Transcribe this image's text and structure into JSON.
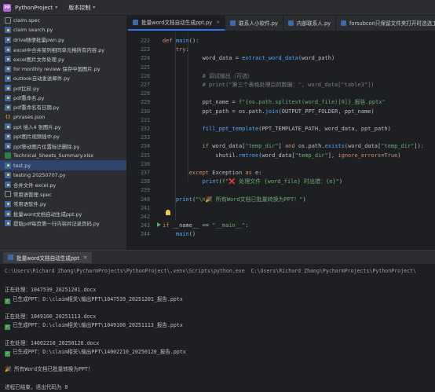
{
  "titlebar": {
    "app_logo": "PP",
    "project_name": "PythonProject",
    "vcs_label": "版本控制"
  },
  "project_tree": {
    "items": [
      {
        "label": "claim.spec",
        "type": "spec"
      },
      {
        "label": "claim search.py",
        "type": "py"
      },
      {
        "label": "drive随便批量pwn.py",
        "type": "py"
      },
      {
        "label": "excel中合并某列相同单元格所有内容.py",
        "type": "py"
      },
      {
        "label": "excel图片文件处理.py",
        "type": "py"
      },
      {
        "label": "for monthly review 保存中国图片.py",
        "type": "py"
      },
      {
        "label": "outlook自动发送邮件.py",
        "type": "py"
      },
      {
        "label": "pdf比较.py",
        "type": "py"
      },
      {
        "label": "pdf重命名.py",
        "type": "py"
      },
      {
        "label": "pdf重命名有日期.py",
        "type": "py"
      },
      {
        "label": "phrases.json",
        "type": "json"
      },
      {
        "label": "ppt 插入4 张图片.py",
        "type": "py"
      },
      {
        "label": "ppt图片视频插中.py",
        "type": "py"
      },
      {
        "label": "ppt移动图片位置标识删除.py",
        "type": "py"
      },
      {
        "label": "Technical_Sheets_Summary.xlsx",
        "type": "xlsx"
      },
      {
        "label": "test.py",
        "type": "py",
        "selected": true
      },
      {
        "label": "testing 20250707.py",
        "type": "py"
      },
      {
        "label": "合并文件 excel.py",
        "type": "py"
      },
      {
        "label": "常用语管理.spec",
        "type": "spec"
      },
      {
        "label": "常用语软件.py",
        "type": "py"
      },
      {
        "label": "批量word文档自动生成ppt.py",
        "type": "py"
      },
      {
        "label": "提取pdf每页第一行内容并记录页码.py",
        "type": "py"
      }
    ]
  },
  "editor_tabs": [
    {
      "label": "批量word文档自动生成ppt.py",
      "active": true
    },
    {
      "label": "联系人小软件.py",
      "active": false
    },
    {
      "label": "内部联系人.py",
      "active": false
    },
    {
      "label": "forsubcon只保留文件夹打开时选选工",
      "active": false
    }
  ],
  "code_lines": [
    {
      "ln": "222",
      "text": "def main():"
    },
    {
      "ln": "223",
      "text": "    try:"
    },
    {
      "ln": "224",
      "text": "            word_data = extract_word_data(word_path)"
    },
    {
      "ln": "225",
      "text": ""
    },
    {
      "ln": "226",
      "text": "            # 调试输出（可选）"
    },
    {
      "ln": "227",
      "text": "            # print(\"第三个表格处理后的数据：\", word_data[\"table3\"])"
    },
    {
      "ln": "228",
      "text": ""
    },
    {
      "ln": "229",
      "text": "            ppt_name = f\"{os.path.splitext(word_file)[0]}_报告.pptx\""
    },
    {
      "ln": "230",
      "text": "            ppt_path = os.path.join(OUTPUT_PPT_FOLDER, ppt_name)"
    },
    {
      "ln": "231",
      "text": ""
    },
    {
      "ln": "232",
      "text": "            fill_ppt_template(PPT_TEMPLATE_PATH, word_data, ppt_path)"
    },
    {
      "ln": "233",
      "text": ""
    },
    {
      "ln": "234",
      "text": "            if word_data[\"temp_dir\"] and os.path.exists(word_data[\"temp_dir\"]):"
    },
    {
      "ln": "235",
      "text": "                shutil.rmtree(word_data[\"temp_dir\"], ignore_errors=True)"
    },
    {
      "ln": "236",
      "text": ""
    },
    {
      "ln": "237",
      "text": "        except Exception as e:"
    },
    {
      "ln": "238",
      "text": "            print(f\"❌ 处理文件 {word_file} 时出错：{e}\")"
    },
    {
      "ln": "239",
      "text": ""
    },
    {
      "ln": "240",
      "text": "    print(\"\\n🎉 所有Word文档已批量转换为PPT！\")"
    },
    {
      "ln": "241",
      "text": ""
    },
    {
      "ln": "242",
      "text": ""
    },
    {
      "ln": "243",
      "text": "if __name__ == \"__main__\":"
    },
    {
      "ln": "244",
      "text": "    main()"
    }
  ],
  "run_window": {
    "tab_label": "批量word文档自动生成ppt",
    "lines": [
      {
        "text": "C:\\Users\\Richard Zhang\\PycharmProjects\\PythonProject\\.venv\\Scripts\\python.exe  C:\\Users\\Richard Zhang\\PycharmProjects\\PythonProject\\",
        "kind": "dim"
      },
      {
        "text": "",
        "kind": "plain"
      },
      {
        "text": "正在处理：1047539_20251201.docx",
        "kind": "plain"
      },
      {
        "text": "已生成PPT：D:\\claim相关\\输出PPT\\1047539_20251201_报告.pptx",
        "kind": "check"
      },
      {
        "text": "",
        "kind": "plain"
      },
      {
        "text": "正在处理：1049100_20251113.docx",
        "kind": "plain"
      },
      {
        "text": "已生成PPT：D:\\claim相关\\输出PPT\\1049100_20251113_报告.pptx",
        "kind": "check"
      },
      {
        "text": "",
        "kind": "plain"
      },
      {
        "text": "正在处理：14002210_20250120.docx",
        "kind": "plain"
      },
      {
        "text": "已生成PPT：D:\\claim相关\\输出PPT\\14002210_20250120_报告.pptx",
        "kind": "check"
      },
      {
        "text": "",
        "kind": "plain"
      },
      {
        "text": "🎉 所有Word文档已批量转换为PPT！",
        "kind": "plain"
      },
      {
        "text": "",
        "kind": "plain"
      },
      {
        "text": "进程已结束，退出代码为 0",
        "kind": "plain"
      }
    ]
  },
  "colors": {
    "background": "#1e1f22",
    "panel": "#2b2d30",
    "selection": "#2e436e",
    "accent": "#3574f0",
    "keyword": "#cf8e6d",
    "function": "#56a8f5",
    "string": "#6aab73",
    "comment": "#7a7e85",
    "success": "#3d9a4e"
  }
}
